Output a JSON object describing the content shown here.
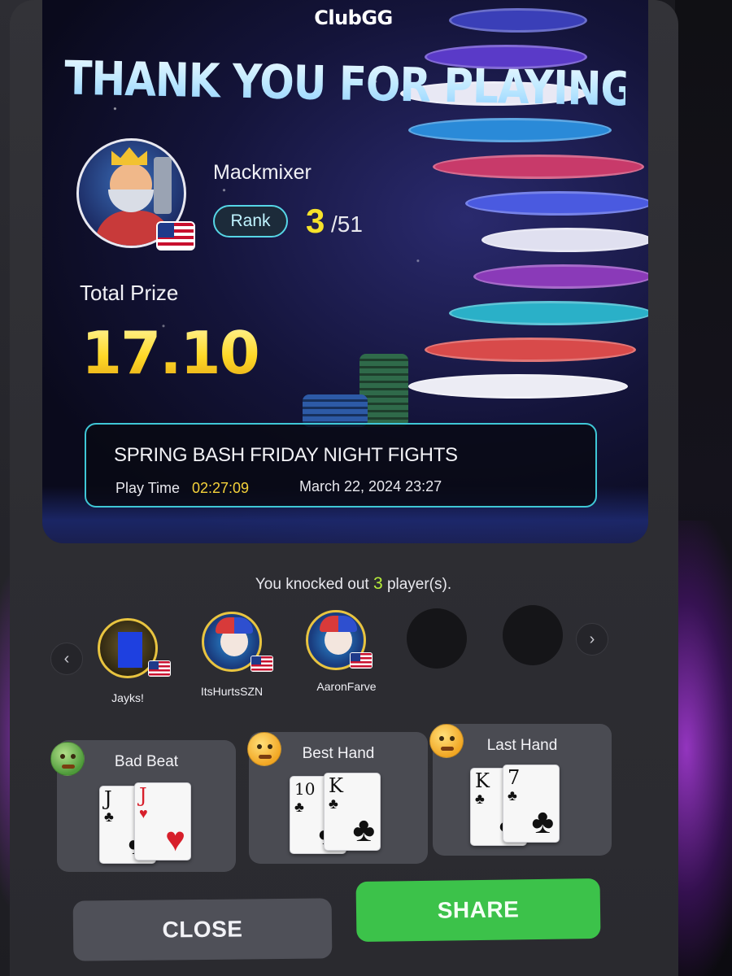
{
  "brand": "ClubGG",
  "headline": "THANK YOU FOR PLAYING!",
  "player": {
    "name": "Mackmixer",
    "rank_label": "Rank",
    "rank": "3",
    "rank_total": "51"
  },
  "prize": {
    "label": "Total Prize",
    "value": "17.10"
  },
  "tournament": {
    "name": "SPRING BASH FRIDAY NIGHT FIGHTS",
    "play_time_label": "Play Time",
    "play_time": "02:27:09",
    "date": "March 22, 2024 23:27"
  },
  "knockouts": {
    "prefix": "You knocked out",
    "count": "3",
    "suffix": "player(s).",
    "players": [
      {
        "name": "Jayks!"
      },
      {
        "name": "ItsHurtsSZN"
      },
      {
        "name": "AaronFarve"
      }
    ],
    "prev_icon": "‹",
    "next_icon": "›"
  },
  "hands": [
    {
      "title": "Bad Beat",
      "cards": [
        {
          "rank": "J",
          "suit": "♣"
        },
        {
          "rank": "J",
          "suit": "♥"
        }
      ]
    },
    {
      "title": "Best Hand",
      "cards": [
        {
          "rank": "10",
          "suit": "♣"
        },
        {
          "rank": "K",
          "suit": "♣"
        }
      ]
    },
    {
      "title": "Last Hand",
      "cards": [
        {
          "rank": "K",
          "suit": "♣"
        },
        {
          "rank": "7",
          "suit": "♣"
        }
      ]
    }
  ],
  "buttons": {
    "close": "CLOSE",
    "share": "SHARE"
  },
  "colors": {
    "accent_yellow": "#f6e22a",
    "accent_cyan": "#3fc7d6",
    "share_green": "#3cc24a",
    "knockout_green": "#b7ee3a"
  }
}
